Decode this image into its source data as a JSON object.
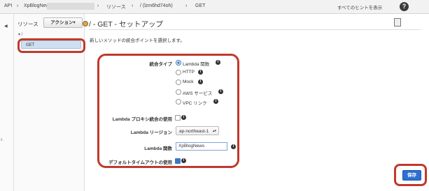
{
  "topbar": {
    "api": "API",
    "sep1": "›",
    "api_name": "XpBlogNews",
    "sep2": "›",
    "resources": "リソース",
    "sep3": "›",
    "path": "/ (lzm6hd74oh)",
    "sep4": "›",
    "method": "GET",
    "show_all_hints": "すべてのヒントを表示",
    "help_glyph": "?"
  },
  "resources_panel": {
    "title": "リソース",
    "actions_label": "アクション▾",
    "root": "▾ /",
    "selected_item": "GET"
  },
  "main": {
    "title": "/ - GET - セットアップ",
    "description": "新しいメソッドの統合ポイントを選択します。",
    "integration_type_label": "統合タイプ",
    "options": [
      "Lambda 関数",
      "HTTP",
      "Mock",
      "AWS サービス",
      "VPC リンク"
    ],
    "selected_option": "Lambda 関数",
    "lambda_proxy_label": "Lambda プロキシ統合の使用",
    "lambda_proxy_checked": false,
    "lambda_region_label": "Lambda リージョン",
    "lambda_region_value": "ap-northeast-1",
    "lambda_function_label": "Lambda 関数",
    "lambda_function_value": "XpBlogNews",
    "default_timeout_label": "デフォルトタイムアウトの使用",
    "default_timeout_checked": true,
    "save_label": "保存",
    "info_glyph": "i"
  },
  "colors": {
    "highlight_ring": "#c0392b",
    "primary_button": "#2e6fd1",
    "selected_item": "#cfdff0"
  }
}
